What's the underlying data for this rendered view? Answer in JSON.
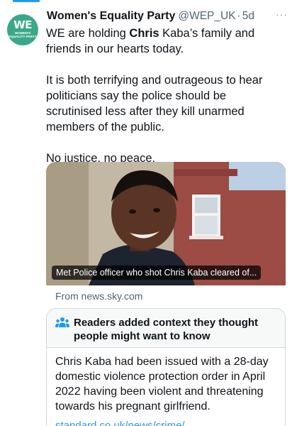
{
  "account": {
    "name": "Women's Equality Party",
    "handle": "@WEP_UK",
    "separator": "·",
    "time": "5d",
    "avatar_text": "WE",
    "avatar_subtext": "WOMEN'S EQUALITY PARTY"
  },
  "more_label": "···",
  "tweet": {
    "paragraph1_start": "WE are holding ",
    "paragraph1_bold": "Chris",
    "paragraph1_end": " Kaba’s family and friends in our hearts today.",
    "paragraph2": "It is both terrifying and outrageous to hear politicians say the police should be scrutinised less after they kill unarmed members of the public.",
    "paragraph3": "No justice, no peace."
  },
  "media": {
    "caption": "Met Police officer who shot Chris Kaba cleared of...",
    "source": "From news.sky.com"
  },
  "community_note": {
    "title": "Readers added context they thought people might want to know",
    "body": "Chris Kaba had been issued with a 28-day domestic violence protection order in April 2022 having been violent and threatening towards his pregnant girlfriend.",
    "link": "standard.co.uk/news/crime/..."
  },
  "colors": {
    "avatar_bg": "#3aa888",
    "accent": "#1d9bf0",
    "muted": "#536471"
  },
  "icons": {
    "note_icon": "people-group-icon",
    "more_icon": "more-horizontal-icon"
  }
}
